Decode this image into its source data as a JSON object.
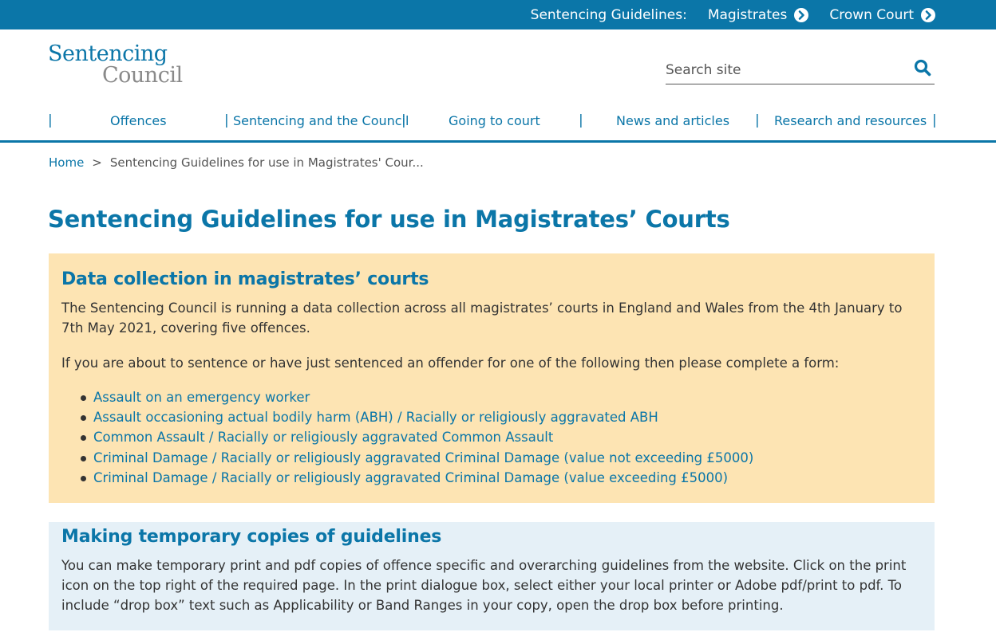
{
  "topbar": {
    "label": "Sentencing Guidelines:",
    "links": [
      "Magistrates",
      "Crown Court"
    ]
  },
  "logo": {
    "line1": "Sentencing",
    "line2": "Council"
  },
  "search": {
    "placeholder": "Search site"
  },
  "nav": {
    "items": [
      "Offences",
      "Sentencing and the Council",
      "Going to court",
      "News and articles",
      "Research and resources"
    ],
    "separator": "|"
  },
  "breadcrumb": {
    "home": "Home",
    "separator": ">",
    "current": "Sentencing Guidelines for use in Magistrates' Cour..."
  },
  "page": {
    "title": "Sentencing Guidelines for use in Magistrates’ Courts"
  },
  "data_collection": {
    "heading": "Data collection in magistrates’ courts",
    "intro": "The Sentencing Council is running a data collection across all magistrates’ courts in England and Wales from the 4th January to 7th May 2021, covering five offences.",
    "instruction": "If you are about to sentence or have just sentenced an offender for one of the following then please complete a form:",
    "offences": [
      "Assault on an emergency worker",
      "Assault occasioning actual bodily harm (ABH) / Racially or religiously aggravated ABH",
      "Common Assault / Racially or religiously aggravated Common Assault",
      "Criminal Damage / Racially or religiously aggravated Criminal Damage (value not exceeding £5000)",
      "Criminal Damage / Racially or religiously aggravated Criminal Damage (value exceeding £5000)"
    ]
  },
  "temporary_copies": {
    "heading": "Making temporary copies of guidelines",
    "body": "You can make temporary print and pdf copies of offence specific and overarching guidelines from the website. Click on the print icon on the top right of the required page. In the print dialogue box, select either your local printer or Adobe pdf/print to pdf. To include “drop box” text such as Applicability or Band Ranges in your copy, open the drop box before printing."
  },
  "colors": {
    "brand_blue": "#0b76a8",
    "notice_yellow": "#fde4b3",
    "info_blue": "#e5f0f7",
    "logo_grey": "#8a8a8a"
  },
  "icons": {
    "topbar_link_icon": "chevron-right-circle-icon",
    "search_icon": "magnifier-icon"
  }
}
